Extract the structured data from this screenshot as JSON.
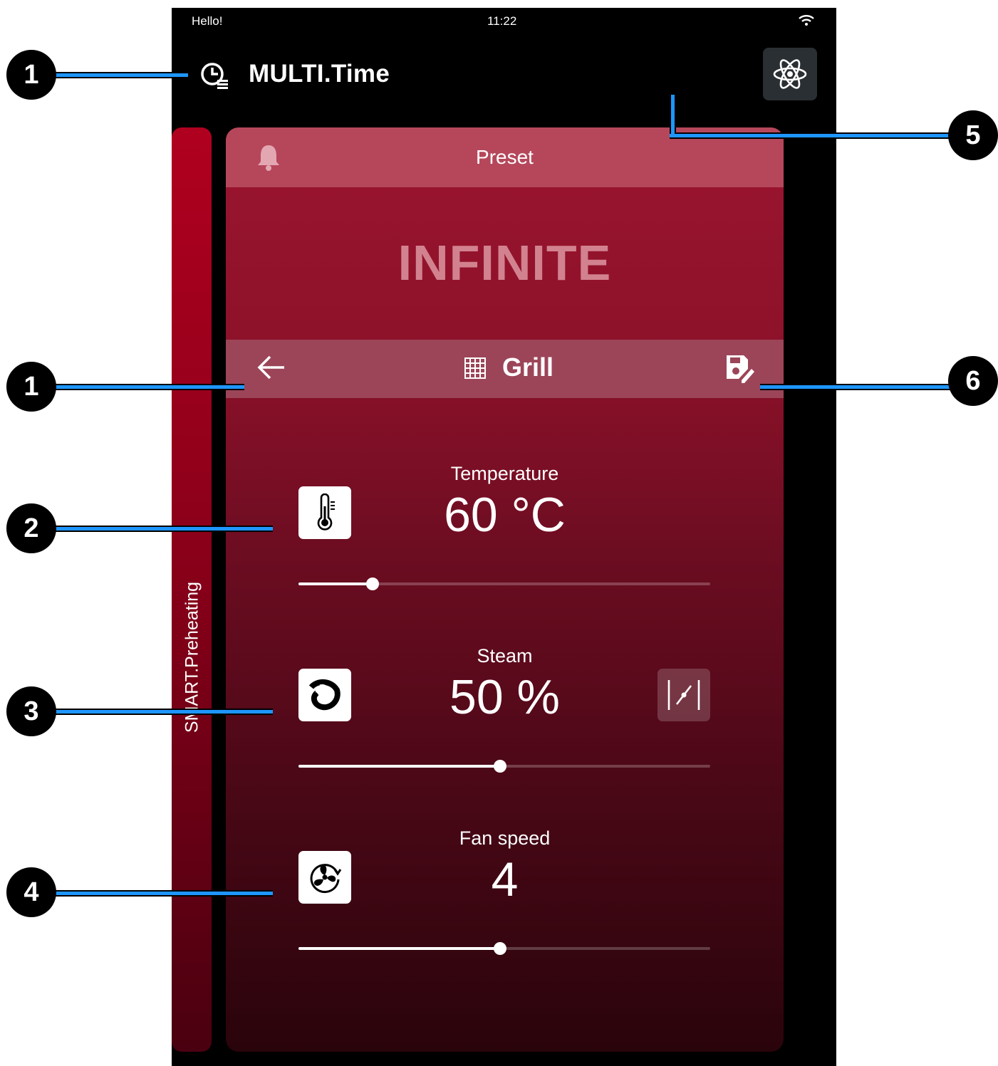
{
  "status_bar": {
    "greeting": "Hello!",
    "time": "11:22",
    "wifi_icon": "wifi-icon"
  },
  "app_bar": {
    "title": "MULTI.Time",
    "mode_icon": "timer-list-icon",
    "action_icon": "atom-icon"
  },
  "side_card": {
    "label": "SMART.Preheating"
  },
  "card": {
    "header_label": "Preset",
    "header_icon": "bell-icon",
    "duration_text": "INFINITE",
    "mode_bar": {
      "back_icon": "arrow-left-icon",
      "mode_icon": "grill-grid-icon",
      "mode_label": "Grill",
      "save_icon": "save-edit-icon"
    },
    "params": {
      "temperature": {
        "label": "Temperature",
        "value": "60 °C",
        "icon": "thermometer-icon",
        "slider_fraction": 0.18
      },
      "steam": {
        "label": "Steam",
        "value": "50 %",
        "icon": "steam-icon",
        "extra_icon": "curve-adjust-icon",
        "slider_fraction": 0.49
      },
      "fan": {
        "label": "Fan speed",
        "value": "4",
        "icon": "fan-icon",
        "slider_fraction": 0.49
      }
    }
  },
  "callouts": [
    "1",
    "1",
    "2",
    "3",
    "4",
    "5",
    "6"
  ],
  "colors": {
    "accent_red": "#9c1530",
    "callout_line": "#1e96ff",
    "background": "#000000"
  }
}
